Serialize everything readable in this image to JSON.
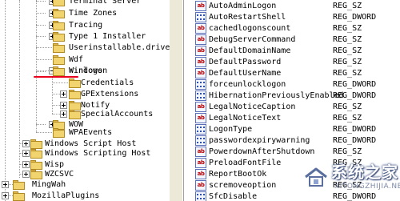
{
  "tree": {
    "items": [
      {
        "label": "Terminal Server",
        "expander": "plus"
      },
      {
        "label": "Time Zones",
        "expander": "plus"
      },
      {
        "label": "Tracing",
        "expander": "plus"
      },
      {
        "label": "Type 1 Installer",
        "expander": "plus"
      },
      {
        "label": "Userinstallable.drivers",
        "expander": "none"
      },
      {
        "label": "Wdf",
        "expander": "none"
      },
      {
        "label": "Windows",
        "expander": "none"
      },
      {
        "label": "Winlogon",
        "expander": "minus",
        "selected": true
      },
      {
        "label": "Credentials",
        "expander": "none"
      },
      {
        "label": "GPExtensions",
        "expander": "plus"
      },
      {
        "label": "Notify",
        "expander": "plus"
      },
      {
        "label": "SpecialAccounts",
        "expander": "plus"
      },
      {
        "label": "WOW",
        "expander": "plus"
      },
      {
        "label": "WPAEvents",
        "expander": "none"
      },
      {
        "label": "Windows Script Host",
        "expander": "plus"
      },
      {
        "label": "Windows Scripting Host",
        "expander": "plus"
      },
      {
        "label": "Wisp",
        "expander": "plus"
      },
      {
        "label": "WZCSVC",
        "expander": "plus"
      },
      {
        "label": "MingWah",
        "expander": "plus"
      },
      {
        "label": "MozillaPlugins",
        "expander": "plus"
      }
    ]
  },
  "values": [
    {
      "name": "AutoAdminLogon",
      "type": "REG_SZ",
      "icon": "string-value-icon"
    },
    {
      "name": "AutoRestartShell",
      "type": "REG_DWORD",
      "icon": "dword-value-icon"
    },
    {
      "name": "cachedlogonscount",
      "type": "REG_SZ",
      "icon": "string-value-icon"
    },
    {
      "name": "DebugServerCommand",
      "type": "REG_SZ",
      "icon": "string-value-icon"
    },
    {
      "name": "DefaultDomainName",
      "type": "REG_SZ",
      "icon": "string-value-icon"
    },
    {
      "name": "DefaultPassword",
      "type": "REG_SZ",
      "icon": "string-value-icon"
    },
    {
      "name": "DefaultUserName",
      "type": "REG_SZ",
      "icon": "string-value-icon"
    },
    {
      "name": "forceunlocklogon",
      "type": "REG_DWORD",
      "icon": "dword-value-icon"
    },
    {
      "name": "HibernationPreviouslyEnabled",
      "type": "REG_DWORD",
      "icon": "dword-value-icon"
    },
    {
      "name": "LegalNoticeCaption",
      "type": "REG_SZ",
      "icon": "string-value-icon"
    },
    {
      "name": "LegalNoticeText",
      "type": "REG_SZ",
      "icon": "string-value-icon"
    },
    {
      "name": "LogonType",
      "type": "REG_DWORD",
      "icon": "dword-value-icon"
    },
    {
      "name": "passwordexpirywarning",
      "type": "REG_DWORD",
      "icon": "dword-value-icon"
    },
    {
      "name": "PowerdownAfterShutdown",
      "type": "REG_SZ",
      "icon": "string-value-icon"
    },
    {
      "name": "PreloadFontFile",
      "type": "REG_SZ",
      "icon": "string-value-icon"
    },
    {
      "name": "ReportBootOk",
      "type": "REG_SZ",
      "icon": "string-value-icon"
    },
    {
      "name": "scremoveoption",
      "type": "REG_SZ",
      "icon": "string-value-icon"
    },
    {
      "name": "SfcDisable",
      "type": "REG_DWORD",
      "icon": "dword-value-icon"
    }
  ],
  "watermark": {
    "title": "系统之家",
    "site": "XITONGZHIJIA.NET"
  },
  "colors": {
    "accent_red": "#e8001c",
    "folder_yellow": "#f2d46e",
    "splitter_gray": "#ece9d8"
  }
}
